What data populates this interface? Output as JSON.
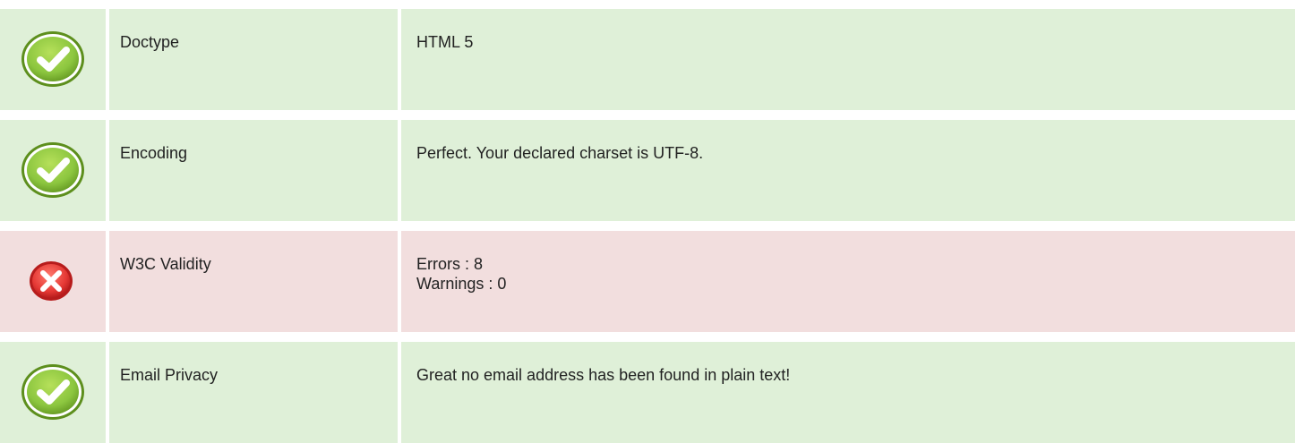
{
  "rows": [
    {
      "status": "pass",
      "icon": "check-circle-icon",
      "label": "Doctype",
      "values": [
        "HTML 5"
      ]
    },
    {
      "status": "pass",
      "icon": "check-circle-icon",
      "label": "Encoding",
      "values": [
        "Perfect. Your declared charset is UTF-8."
      ]
    },
    {
      "status": "fail",
      "icon": "x-circle-icon",
      "label": "W3C Validity",
      "values": [
        "Errors : 8",
        "Warnings : 0"
      ]
    },
    {
      "status": "pass",
      "icon": "check-circle-icon",
      "label": "Email Privacy",
      "values": [
        "Great no email address has been found in plain text!"
      ]
    }
  ],
  "colors": {
    "pass_background": "#dff0d8",
    "fail_background": "#f2dede",
    "pass_icon": "#8cc63f",
    "fail_icon": "#e53935"
  }
}
